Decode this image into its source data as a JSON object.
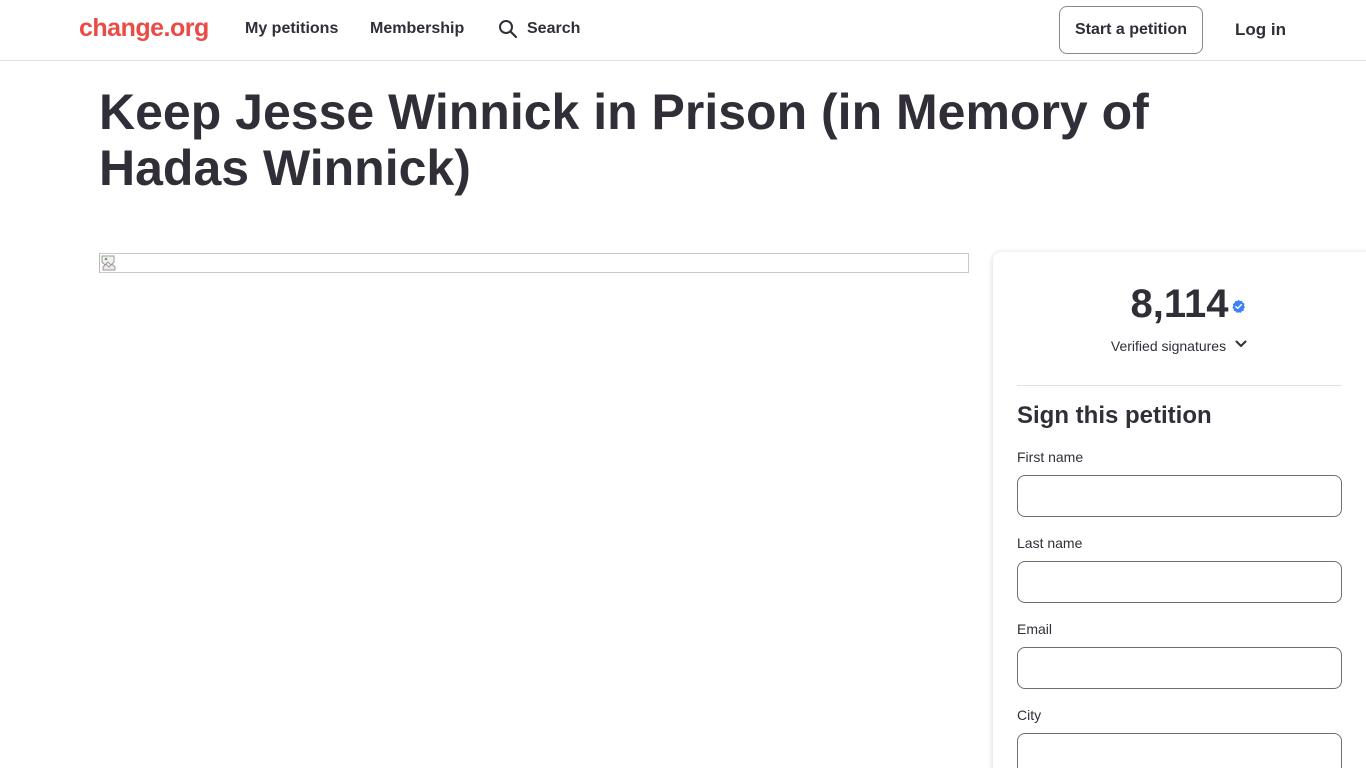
{
  "header": {
    "logo": "change.org",
    "nav": {
      "my_petitions": "My petitions",
      "membership": "Membership",
      "search": "Search"
    },
    "start_petition": "Start a petition",
    "login": "Log in"
  },
  "petition": {
    "title": "Keep Jesse Winnick in Prison (in Memory of Hadas Winnick)"
  },
  "sign_card": {
    "count": "8,114",
    "verified_label": "Verified signatures",
    "heading": "Sign this petition",
    "fields": [
      {
        "label": "First name",
        "value": ""
      },
      {
        "label": "Last name",
        "value": ""
      },
      {
        "label": "Email",
        "value": ""
      },
      {
        "label": "City",
        "value": ""
      }
    ]
  },
  "colors": {
    "brand": "#eb4b46",
    "text": "#312e38",
    "verified": "#3b82f6"
  },
  "icons": [
    "search-icon",
    "broken-image-icon",
    "verified-badge-icon",
    "chevron-down-icon"
  ]
}
